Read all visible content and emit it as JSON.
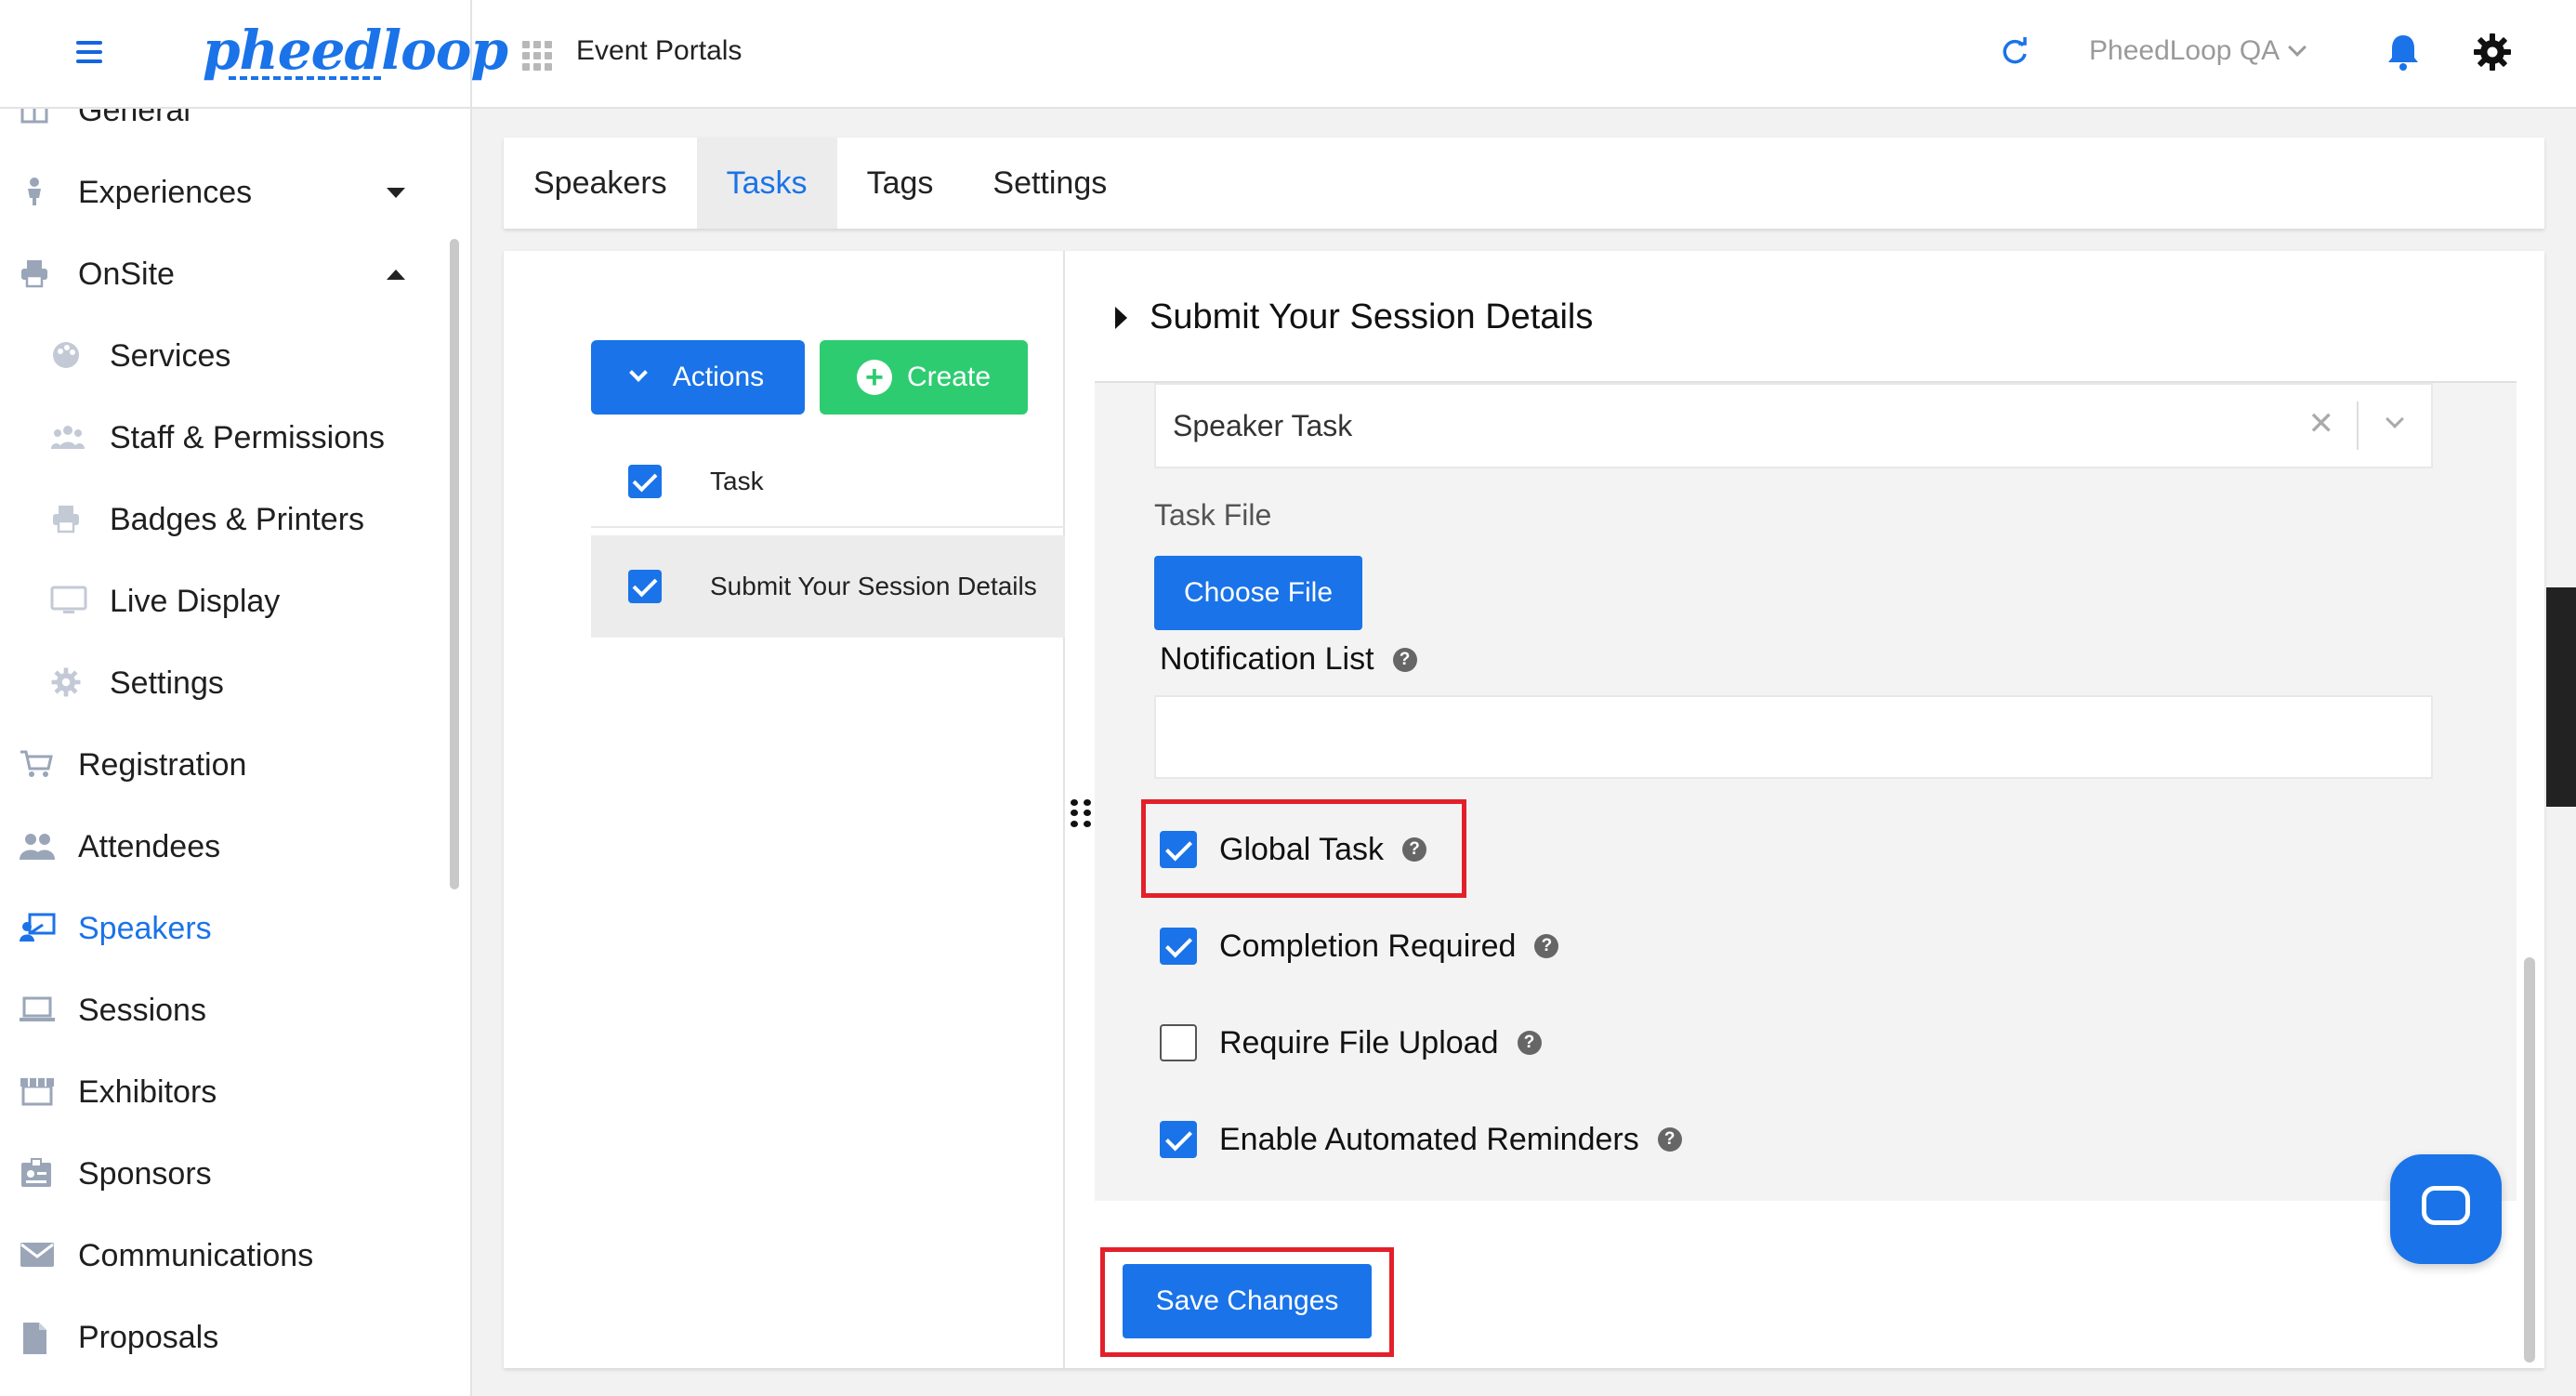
{
  "header": {
    "logo_text": "pheedloop",
    "portal_title": "Event Portals",
    "org_name": "PheedLoop QA"
  },
  "sidebar": {
    "items": [
      {
        "label": "General",
        "icon": "grid-icon"
      },
      {
        "label": "Experiences",
        "icon": "person-icon"
      },
      {
        "label": "OnSite",
        "icon": "printer-icon"
      },
      {
        "label": "Services",
        "icon": "palette-icon"
      },
      {
        "label": "Staff & Permissions",
        "icon": "people-icon"
      },
      {
        "label": "Badges & Printers",
        "icon": "printer-icon"
      },
      {
        "label": "Live Display",
        "icon": "monitor-icon"
      },
      {
        "label": "Settings",
        "icon": "gear-icon"
      },
      {
        "label": "Registration",
        "icon": "cart-icon"
      },
      {
        "label": "Attendees",
        "icon": "people-icon"
      },
      {
        "label": "Speakers",
        "icon": "presenter-icon"
      },
      {
        "label": "Sessions",
        "icon": "laptop-icon"
      },
      {
        "label": "Exhibitors",
        "icon": "store-icon"
      },
      {
        "label": "Sponsors",
        "icon": "badge-icon"
      },
      {
        "label": "Communications",
        "icon": "mail-icon"
      },
      {
        "label": "Proposals",
        "icon": "document-icon"
      }
    ],
    "active": "Speakers"
  },
  "tabs": [
    {
      "label": "Speakers"
    },
    {
      "label": "Tasks"
    },
    {
      "label": "Tags"
    },
    {
      "label": "Settings"
    }
  ],
  "active_tab": "Tasks",
  "task_list": {
    "actions_label": "Actions",
    "create_label": "Create",
    "header_label": "Task",
    "rows": [
      {
        "label": "Submit Your Session Details",
        "checked": true
      }
    ]
  },
  "task_detail": {
    "title": "Submit Your Session Details",
    "task_type_value": "Speaker Task",
    "task_file_label": "Task File",
    "choose_file_label": "Choose File",
    "notification_list_label": "Notification List",
    "notification_list_value": "",
    "options": [
      {
        "label": "Global Task",
        "checked": true
      },
      {
        "label": "Completion Required",
        "checked": true
      },
      {
        "label": "Require File Upload",
        "checked": false
      },
      {
        "label": "Enable Automated Reminders",
        "checked": true
      }
    ],
    "save_label": "Save Changes"
  },
  "help_glyph": "?",
  "clear_glyph": "✕",
  "colors": {
    "accent": "#1a73e8",
    "create": "#2ecc71",
    "highlight": "#e3202a"
  }
}
